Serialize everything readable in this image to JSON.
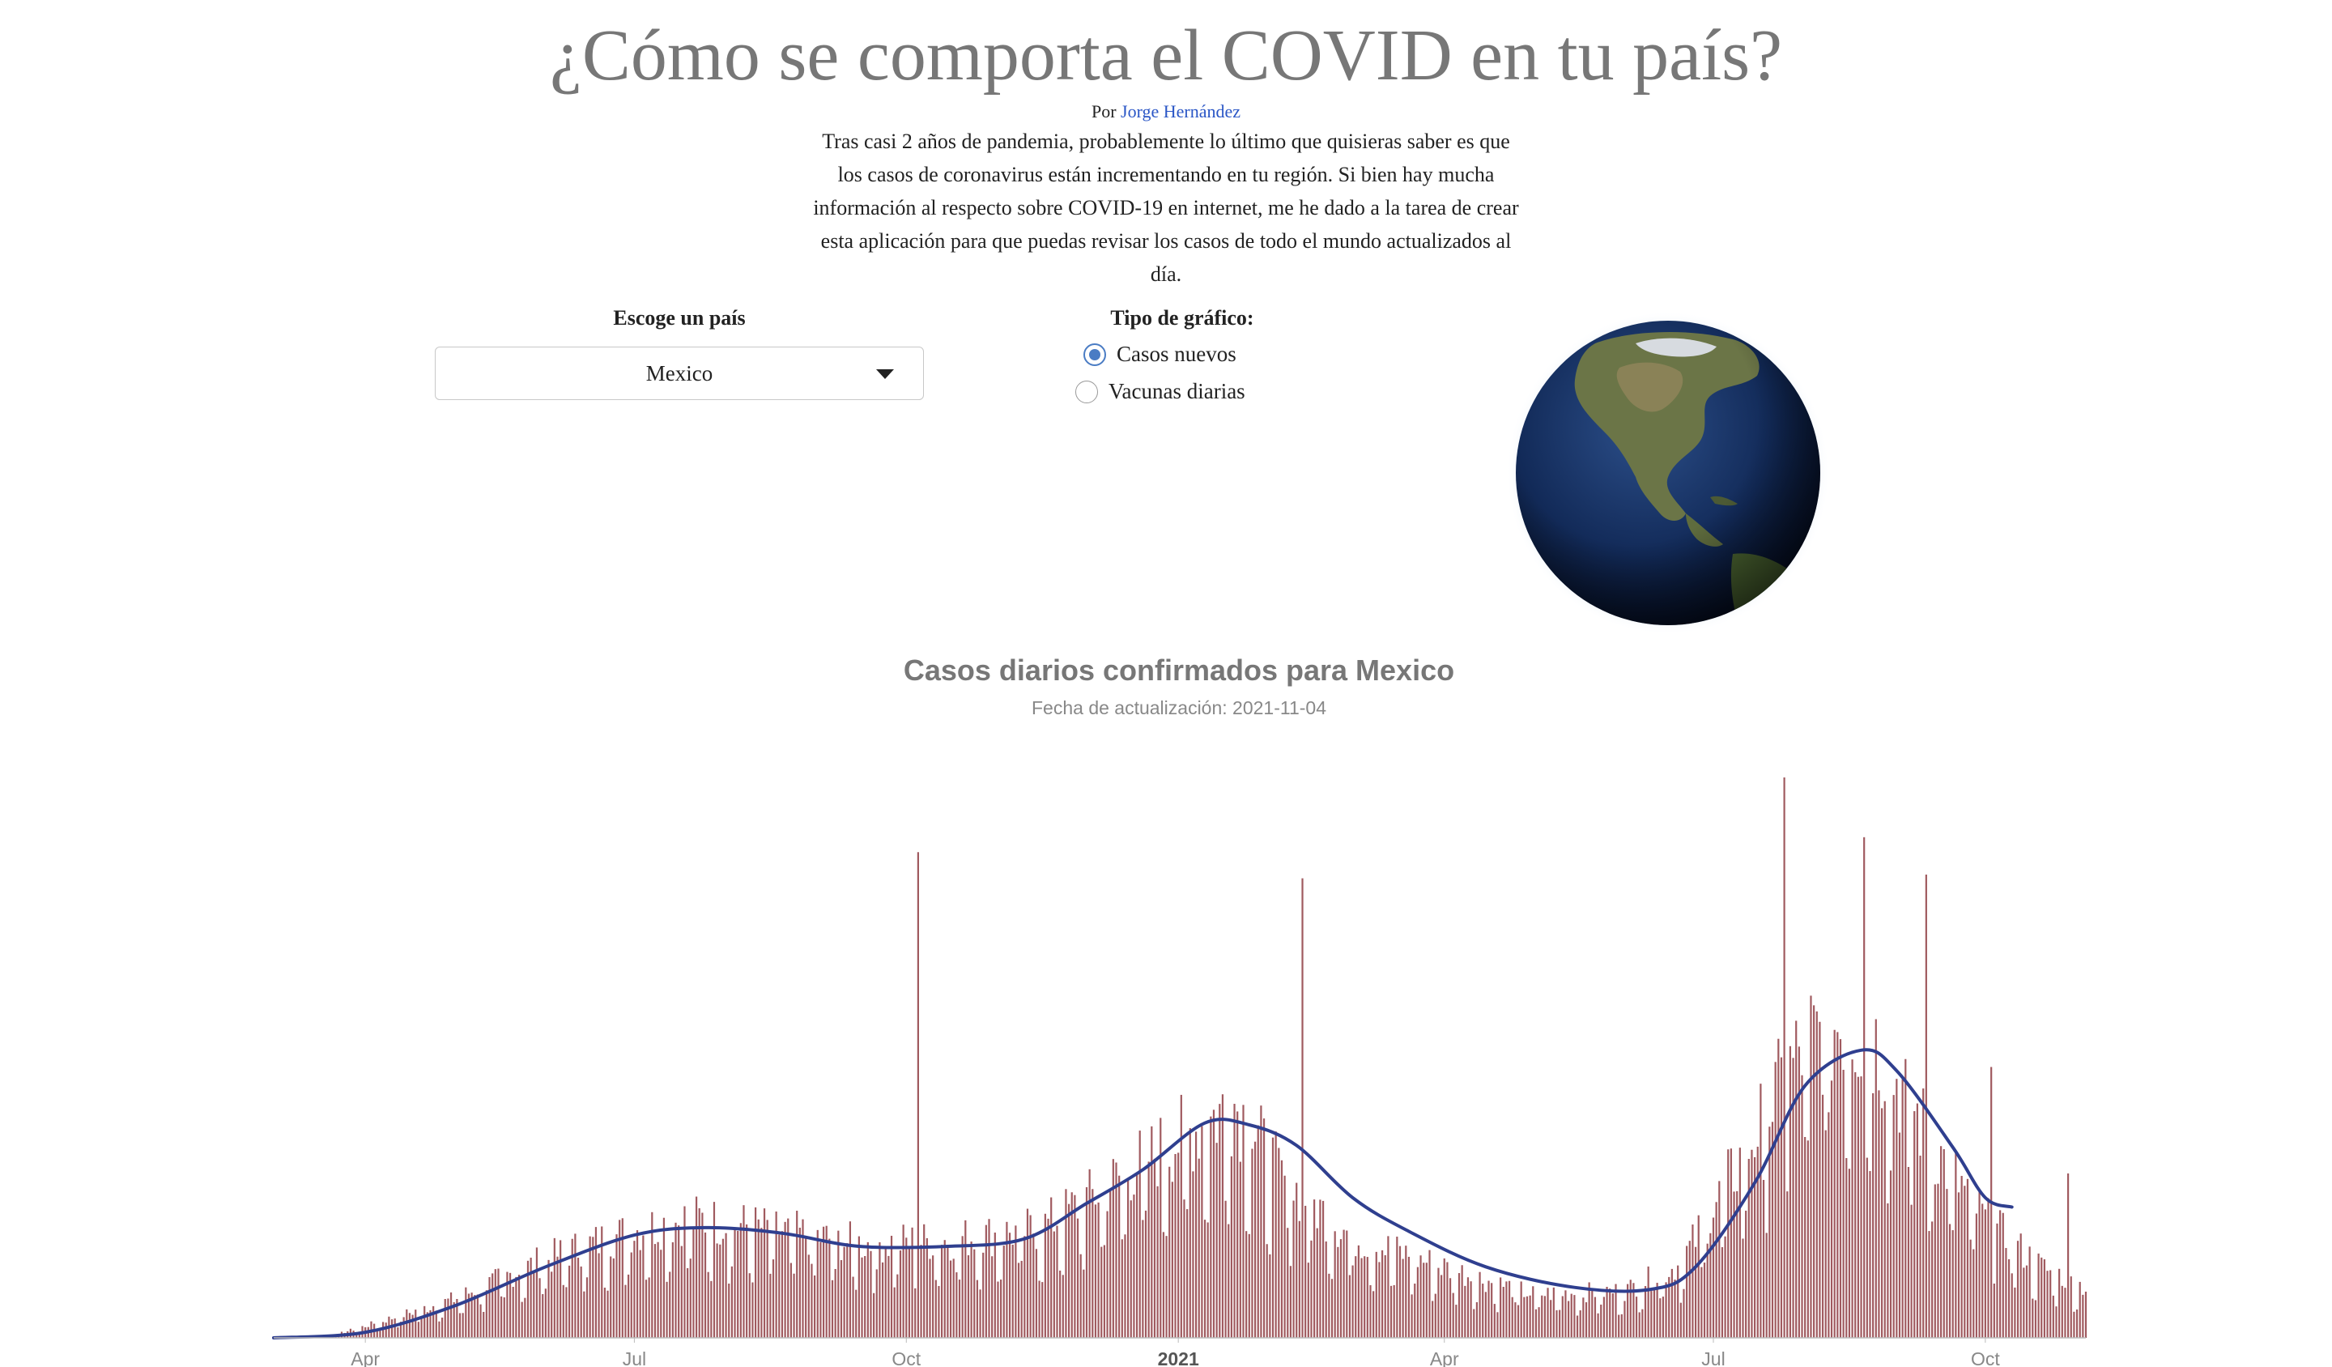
{
  "header": {
    "title": "¿Cómo se comporta el COVID en tu país?",
    "byline_prefix": "Por",
    "author": "Jorge Hernández",
    "intro": "Tras casi 2 años de pandemia, probablemente lo último que quisieras saber es que los casos de coronavirus están incrementando en tu región. Si bien hay mucha información al respecto sobre COVID-19 en internet, me he dado a la tarea de crear esta aplicación para que puedas revisar los casos de todo el mundo actualizados al día."
  },
  "controls": {
    "country_label": "Escoge un país",
    "country_value": "Mexico",
    "chart_type_label": "Tipo de gráfico:",
    "chart_types": [
      {
        "label": "Casos nuevos",
        "selected": true
      },
      {
        "label": "Vacunas diarias",
        "selected": false
      }
    ]
  },
  "icons": {
    "globe": "globe-icon",
    "dropdown": "caret-down-icon"
  },
  "colors": {
    "bars": "#a05a5f",
    "avg_line": "#2f3f8f",
    "title": "#777777",
    "link": "#2a56c6",
    "radio": "#4a7cc4"
  },
  "chart_data": {
    "type": "bar",
    "title": "Casos diarios confirmados para Mexico",
    "subtitle": "Fecha de actualización: 2021-11-04",
    "xlabel": "",
    "ylabel": "",
    "x_range": [
      "2020-03-01",
      "2021-11-04"
    ],
    "x_ticks": [
      {
        "date": "2020-04-01",
        "label": "Apr"
      },
      {
        "date": "2020-07-01",
        "label": "Jul"
      },
      {
        "date": "2020-10-01",
        "label": "Oct"
      },
      {
        "date": "2021-01-01",
        "label": "2021"
      },
      {
        "date": "2021-04-01",
        "label": "Apr"
      },
      {
        "date": "2021-07-01",
        "label": "Jul"
      },
      {
        "date": "2021-10-01",
        "label": "Oct"
      }
    ],
    "ylim": [
      0,
      30000
    ],
    "grid": false,
    "series_daily_envelope": [
      [
        "2020-03-01",
        0
      ],
      [
        "2020-03-20",
        100
      ],
      [
        "2020-04-01",
        700
      ],
      [
        "2020-05-01",
        2300
      ],
      [
        "2020-06-01",
        4700
      ],
      [
        "2020-07-01",
        6400
      ],
      [
        "2020-07-20",
        7100
      ],
      [
        "2020-08-15",
        6500
      ],
      [
        "2020-09-15",
        5600
      ],
      [
        "2020-10-15",
        5800
      ],
      [
        "2020-11-15",
        6500
      ],
      [
        "2020-12-01",
        8200
      ],
      [
        "2020-12-20",
        10500
      ],
      [
        "2021-01-10",
        12800
      ],
      [
        "2021-01-20",
        14000
      ],
      [
        "2021-02-05",
        9500
      ],
      [
        "2021-03-01",
        6000
      ],
      [
        "2021-04-01",
        4200
      ],
      [
        "2021-05-01",
        2600
      ],
      [
        "2021-06-01",
        2800
      ],
      [
        "2021-06-20",
        4400
      ],
      [
        "2021-07-10",
        10500
      ],
      [
        "2021-08-01",
        17500
      ],
      [
        "2021-08-15",
        19000
      ],
      [
        "2021-08-25",
        17500
      ],
      [
        "2021-09-15",
        11000
      ],
      [
        "2021-10-01",
        7000
      ],
      [
        "2021-10-20",
        4200
      ],
      [
        "2021-11-04",
        3000
      ]
    ],
    "spikes": [
      [
        "2020-10-05",
        26000
      ],
      [
        "2021-02-12",
        24600
      ],
      [
        "2021-07-25",
        30000
      ],
      [
        "2021-08-21",
        26800
      ],
      [
        "2021-09-11",
        24800
      ],
      [
        "2021-10-03",
        14500
      ],
      [
        "2021-10-29",
        8800
      ]
    ],
    "series_7day_avg": [
      [
        "2020-03-01",
        0
      ],
      [
        "2020-04-01",
        300
      ],
      [
        "2020-05-01",
        1700
      ],
      [
        "2020-06-01",
        3800
      ],
      [
        "2020-07-01",
        5500
      ],
      [
        "2020-07-25",
        5900
      ],
      [
        "2020-08-20",
        5600
      ],
      [
        "2020-09-15",
        4900
      ],
      [
        "2020-10-15",
        4900
      ],
      [
        "2020-11-10",
        5300
      ],
      [
        "2020-12-01",
        7200
      ],
      [
        "2020-12-20",
        9000
      ],
      [
        "2021-01-10",
        11500
      ],
      [
        "2021-01-25",
        11400
      ],
      [
        "2021-02-10",
        10300
      ],
      [
        "2021-03-01",
        7500
      ],
      [
        "2021-03-20",
        5700
      ],
      [
        "2021-04-15",
        3800
      ],
      [
        "2021-05-15",
        2700
      ],
      [
        "2021-06-10",
        2600
      ],
      [
        "2021-06-25",
        3800
      ],
      [
        "2021-07-15",
        8300
      ],
      [
        "2021-08-01",
        13500
      ],
      [
        "2021-08-20",
        15400
      ],
      [
        "2021-09-01",
        14300
      ],
      [
        "2021-09-20",
        10200
      ],
      [
        "2021-10-01",
        7500
      ],
      [
        "2021-10-10",
        7000
      ]
    ]
  }
}
